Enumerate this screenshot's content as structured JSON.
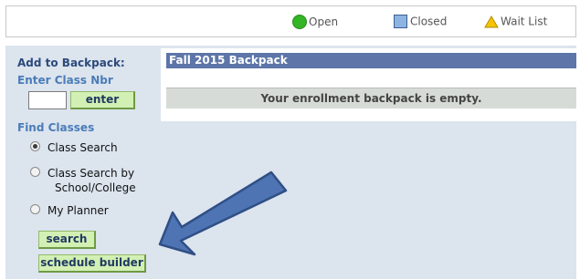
{
  "legend": {
    "open_label": "Open",
    "closed_label": "Closed",
    "waitlist_label": "Wait List",
    "colors": {
      "open": "#33b526",
      "closed": "#8db3e2",
      "waitlist": "#f6c400"
    }
  },
  "sidebar": {
    "add_heading": "Add to Backpack:",
    "enter_class_heading": "Enter Class Nbr",
    "class_nbr_value": "",
    "enter_button": "enter",
    "find_heading": "Find Classes",
    "options": [
      {
        "label_line1": "Class Search",
        "label_line2": "",
        "selected": true
      },
      {
        "label_line1": "Class Search by",
        "label_line2": "School/College",
        "selected": false
      },
      {
        "label_line1": "My Planner",
        "label_line2": "",
        "selected": false
      }
    ],
    "search_button": "search",
    "schedule_button": "schedule builder"
  },
  "backpack": {
    "title": "Fall 2015 Backpack",
    "empty_message": "Your enrollment backpack is empty.",
    "header_color": "#5d75a8"
  },
  "overlay": {
    "icon": "arrow-icon",
    "color": "#4f74b4"
  }
}
